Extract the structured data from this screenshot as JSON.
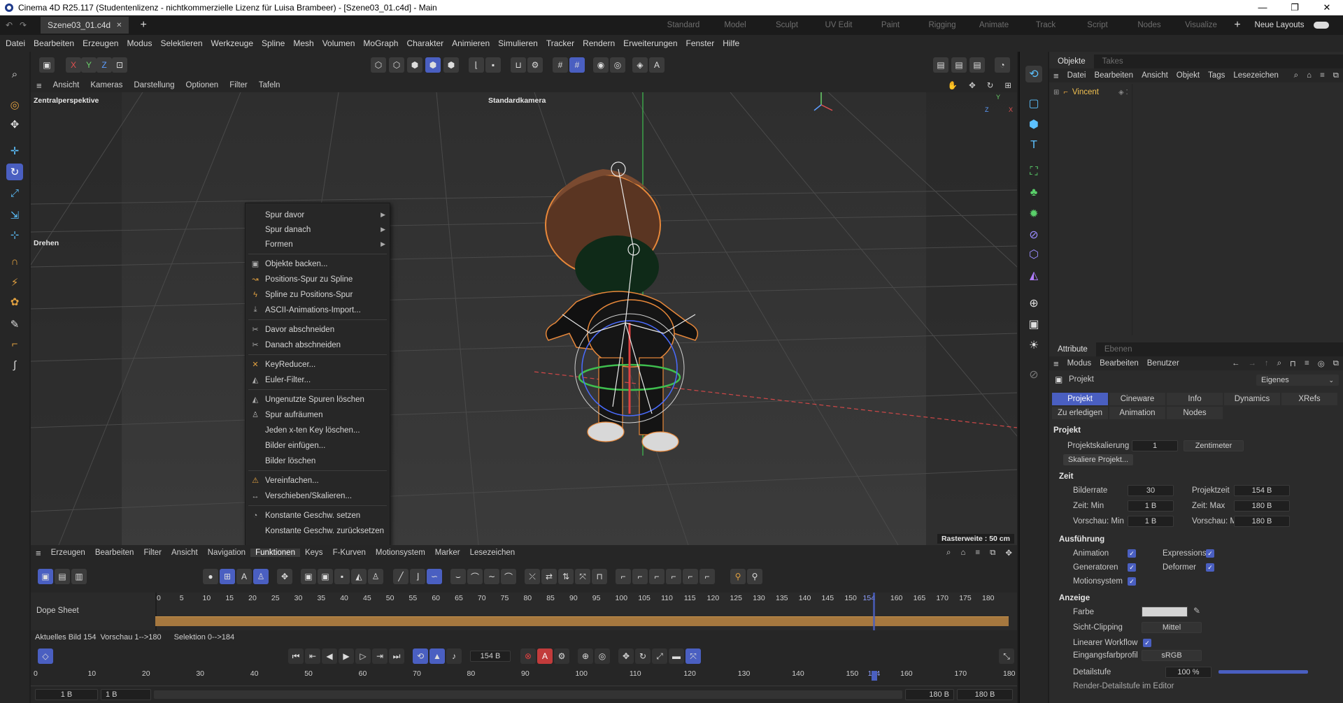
{
  "window": {
    "title": "Cinema 4D R25.117 (Studentenlizenz - nichtkommerzielle Lizenz für Luisa Brambeer) - [Szene03_01.c4d] - Main",
    "minimize": "—",
    "maximize": "❐",
    "close": "✕"
  },
  "tabs": {
    "document": "Szene03_01.c4d",
    "close": "✕",
    "add": "+"
  },
  "layouts": [
    "Standard",
    "Model",
    "Sculpt",
    "UV Edit",
    "Paint",
    "Rigging",
    "Animate",
    "Track",
    "Script",
    "Nodes",
    "Visualize"
  ],
  "layout_add": "+",
  "layout_selector": "Neue Layouts",
  "menu": [
    "Datei",
    "Bearbeiten",
    "Erzeugen",
    "Modus",
    "Selektieren",
    "Werkzeuge",
    "Spline",
    "Mesh",
    "Volumen",
    "MoGraph",
    "Charakter",
    "Animieren",
    "Simulieren",
    "Tracker",
    "Rendern",
    "Erweiterungen",
    "Fenster",
    "Hilfe"
  ],
  "axis_tools": [
    "X",
    "Y",
    "Z"
  ],
  "viewport": {
    "menu": [
      "Ansicht",
      "Kameras",
      "Darstellung",
      "Optionen",
      "Filter",
      "Tafeln"
    ],
    "perspective_label": "Zentralperspektive",
    "camera_label": "Standardkamera",
    "mode_label": "Drehen",
    "grid_label": "Rasterweite : 50 cm",
    "axis_y": "Y",
    "axis_x": "X",
    "axis_z": "Z"
  },
  "context_menu": {
    "items": [
      {
        "label": "Spur davor",
        "submenu": true
      },
      {
        "label": "Spur danach",
        "submenu": true
      },
      {
        "label": "Formen",
        "submenu": true
      },
      {
        "label": "Objekte backen...",
        "icon": "bake-icon"
      },
      {
        "label": "Positions-Spur zu Spline",
        "icon": "spline-icon"
      },
      {
        "label": "Spline zu Positions-Spur",
        "icon": "track-icon"
      },
      {
        "label": "ASCII-Animations-Import...",
        "icon": "import-icon"
      },
      {
        "label": "Davor abschneiden",
        "icon": "scissors-icon"
      },
      {
        "label": "Danach abschneiden",
        "icon": "scissors-icon"
      },
      {
        "label": "KeyReducer...",
        "icon": "keyreducer-icon"
      },
      {
        "label": "Euler-Filter...",
        "icon": "filter-icon"
      },
      {
        "label": "Ungenutzte Spuren löschen",
        "icon": "delete-icon"
      },
      {
        "label": "Spur aufräumen",
        "icon": "broom-icon"
      },
      {
        "label": "Jeden x-ten Key löschen...",
        "icon": ""
      },
      {
        "label": "Bilder einfügen...",
        "icon": ""
      },
      {
        "label": "Bilder löschen",
        "icon": ""
      },
      {
        "label": "Vereinfachen...",
        "icon": "warning-icon"
      },
      {
        "label": "Verschieben/Skalieren...",
        "icon": "move-icon"
      },
      {
        "label": "Konstante Geschw. setzen",
        "icon": "speed-icon"
      },
      {
        "label": "Konstante Geschw. zurücksetzen",
        "icon": ""
      }
    ],
    "arrow": "▶"
  },
  "timeline": {
    "menu": [
      "Erzeugen",
      "Bearbeiten",
      "Filter",
      "Ansicht",
      "Navigation",
      "Funktionen",
      "Keys",
      "F-Kurven",
      "Motionsystem",
      "Marker",
      "Lesezeichen"
    ],
    "active_menu": "Funktionen",
    "track_label": "Dope Sheet",
    "ruler_ticks": [
      "0",
      "5",
      "10",
      "15",
      "20",
      "25",
      "30",
      "35",
      "40",
      "45",
      "50",
      "55",
      "60",
      "65",
      "70",
      "75",
      "80",
      "85",
      "90",
      "95",
      "100",
      "105",
      "110",
      "115",
      "120",
      "125",
      "130",
      "135",
      "140",
      "145",
      "150",
      "154",
      "160",
      "165",
      "170",
      "175",
      "180"
    ],
    "status_current": "Aktuelles Bild  154",
    "status_preview": "Vorschau  1-->180",
    "status_selection": "Selektion 0-->184"
  },
  "playback": {
    "current_frame": "154 B",
    "ruler_ticks": [
      "0",
      "10",
      "20",
      "30",
      "40",
      "50",
      "60",
      "70",
      "80",
      "90",
      "100",
      "110",
      "120",
      "130",
      "140",
      "150",
      "154",
      "160",
      "170",
      "180"
    ],
    "start_field": "1 B",
    "start_field2": "1 B",
    "end_field": "180 B",
    "end_field2": "180 B"
  },
  "objects_panel": {
    "tabs": [
      "Objekte",
      "Takes"
    ],
    "menu": [
      "Datei",
      "Bearbeiten",
      "Ansicht",
      "Objekt",
      "Tags",
      "Lesezeichen"
    ],
    "objects": [
      {
        "name": "Vincent"
      }
    ]
  },
  "attributes_panel": {
    "tabs": [
      "Attribute",
      "Ebenen"
    ],
    "menu": [
      "Modus",
      "Bearbeiten",
      "Benutzer"
    ],
    "object_type": "Projekt",
    "preset": "Eigenes",
    "subtabs": [
      "Projekt",
      "Cineware",
      "Info",
      "Dynamics",
      "XRefs"
    ],
    "subtabs2": [
      "Zu erledigen",
      "Animation",
      "Nodes"
    ],
    "section_title": "Projekt",
    "projektskalierung_label": "Projektskalierung",
    "projektskalierung_value": "1",
    "projektskalierung_unit": "Zentimeter",
    "scale_button": "Skaliere Projekt...",
    "zeit_title": "Zeit",
    "bilderrate_label": "Bilderrate",
    "bilderrate_value": "30",
    "projektzeit_label": "Projektzeit",
    "projektzeit_value": "154 B",
    "zeit_min_label": "Zeit: Min",
    "zeit_min_value": "1 B",
    "zeit_max_label": "Zeit: Max",
    "zeit_max_value": "180 B",
    "vorschau_min_label": "Vorschau: Min",
    "vorschau_min_value": "1 B",
    "vorschau_max_label": "Vorschau: Max",
    "vorschau_max_value": "180 B",
    "ausfuehrung_title": "Ausführung",
    "animation_label": "Animation",
    "expressions_label": "Expressions",
    "generatoren_label": "Generatoren",
    "deformer_label": "Deformer",
    "motionsystem_label": "Motionsystem",
    "anzeige_title": "Anzeige",
    "farbe_label": "Farbe",
    "sicht_clipping_label": "Sicht-Clipping",
    "sicht_clipping_value": "Mittel",
    "linearer_workflow_label": "Linearer Workflow",
    "eingangsfarbprofil_label": "Eingangsfarbprofil",
    "eingangsfarbprofil_value": "sRGB",
    "detailstufe_label": "Detailstufe",
    "detailstufe_value": "100 %",
    "render_detail_label": "Render-Detailstufe im Editor"
  },
  "colors": {
    "accent": "#4a5fc1",
    "background": "#1e1e1e",
    "panel": "#2b2b2b",
    "selection_orange": "#e8a24a",
    "grid": "#474747"
  }
}
